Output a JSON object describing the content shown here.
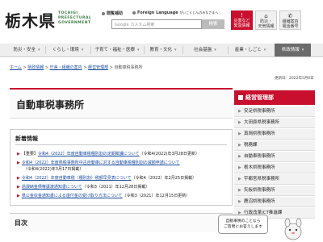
{
  "header": {
    "logo": "栃木県",
    "logo_en": [
      "TOCHIGI",
      "PREFECTURAL",
      "GOVERNMENT"
    ],
    "util_audio": "閲覧補助",
    "util_lang": "Foreign Language",
    "util_lang_sub": "がいこくじんのみなさまへ",
    "search_placeholder": "Google カスタム検索",
    "search_button": "検索",
    "quick": [
      {
        "icon": "!",
        "label": "災害など",
        "label2": "緊急情報"
      },
      {
        "icon": "⌂",
        "label": "防災・",
        "label2": "天気情報"
      },
      {
        "icon": "✆",
        "label": "組織案内",
        "label2": "電話番号"
      }
    ]
  },
  "gnav": [
    "防災・安全",
    "くらし・環境",
    "子育て・福祉・医療",
    "教育・文化",
    "社会基盤",
    "産業・しごと",
    "県政情報"
  ],
  "breadcrumb": {
    "items": [
      "ホーム",
      "県政情報",
      "庁舎・組織の案内",
      "経営管理部"
    ],
    "current": "自動車税事務所",
    "sep": ">"
  },
  "update": "更新日：2022年5月6日",
  "page_title": "自動車税事務所",
  "news": {
    "heading": "新着情報",
    "items": [
      {
        "prefix": "【重要】",
        "link": "令和4（2022）年度自動車税種別割の定期賦課について",
        "date": "（令和4(2022)年3月28日更新）"
      },
      {
        "prefix": "",
        "link": "令和4（2022）年度県税事務所中古自動車に対する自動車税種別割の減額申請について",
        "date": "（令和4(2022)年3月17日掲載）"
      },
      {
        "prefix": "",
        "link": "令和4（2022）年度自動車税（種別割）税額早見表について",
        "date": "（令和4（2022）年2月25日掲載）"
      },
      {
        "prefix": "",
        "link": "過誤納金債権譲渡通知書について",
        "date": "（令和3（2021）年12月28日掲載）"
      },
      {
        "prefix": "",
        "link": "県公金収金通知書による還付金の受け取り方法について",
        "date": "（令和3（2021）年12月15日更新）"
      }
    ]
  },
  "toc": "目次",
  "side": {
    "heading": "経営管理部",
    "items": [
      "安足県税事務所",
      "大田原県税事務所",
      "真岡県税事務所",
      "税務課",
      "自動車税事務所",
      "栃木県税事務所",
      "宇都宮県税事務所",
      "矢板県税事務所",
      "鹿沼県税事務所",
      "行政改革ICT推進課"
    ]
  },
  "chat": {
    "line1": "自動車税のことなら",
    "line2": "ご質問にお答えします"
  },
  "colors": {
    "accent": "#c8102e",
    "link": "#1a4ba0",
    "logo_en": "#3a7d44"
  }
}
